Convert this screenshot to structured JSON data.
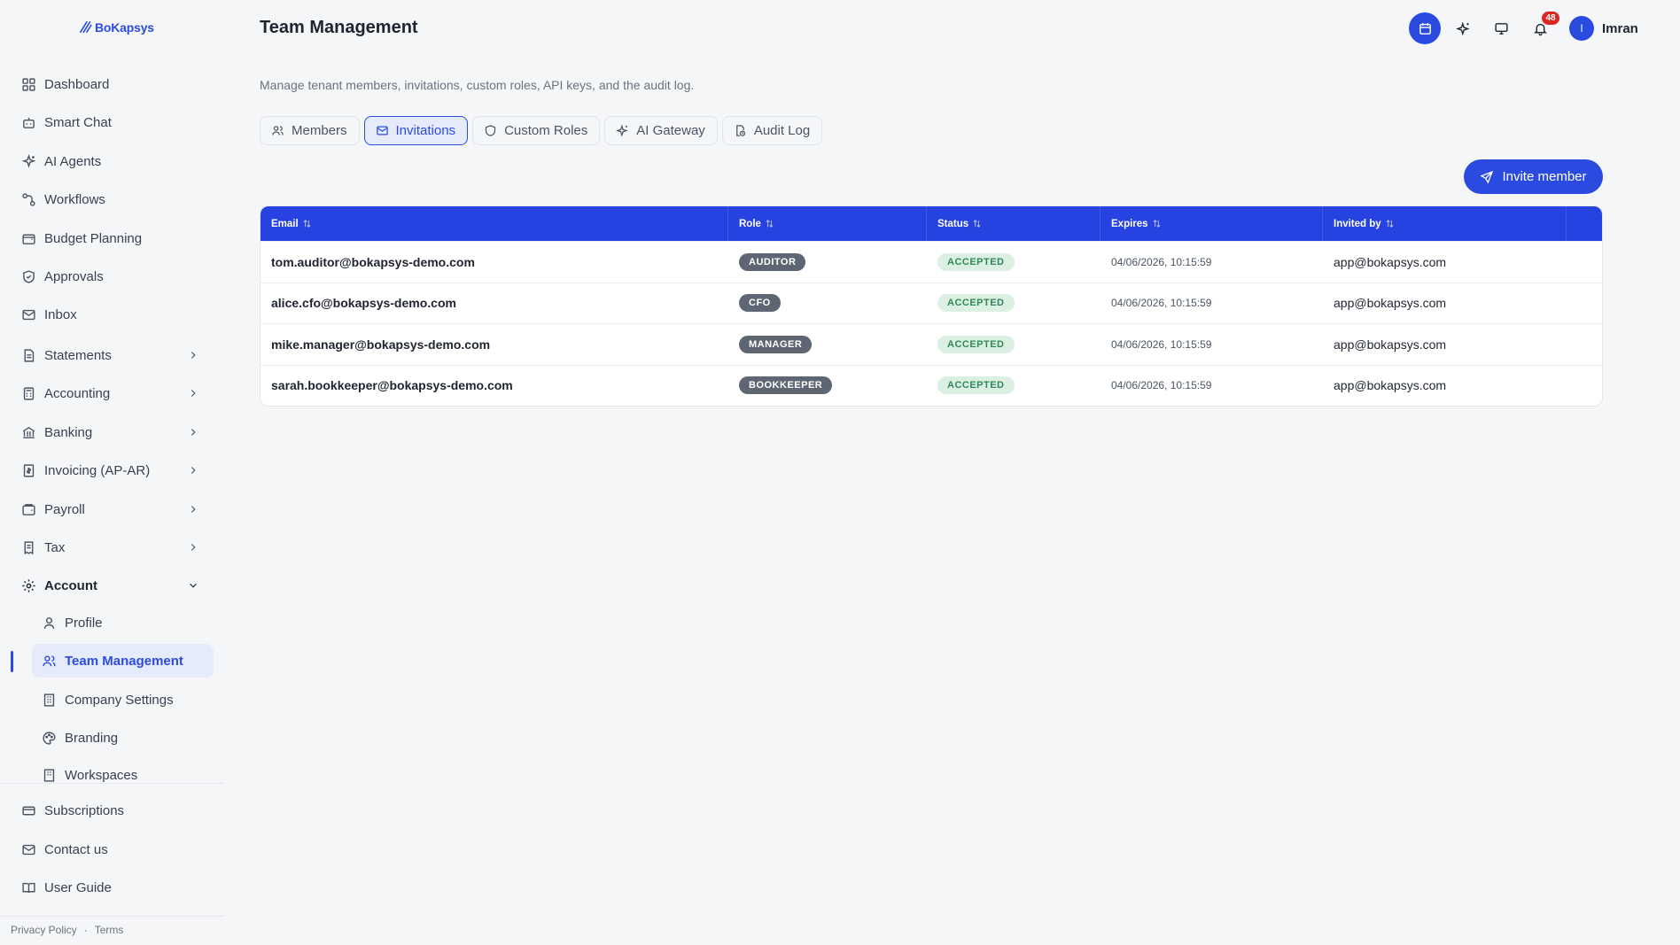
{
  "app": {
    "brand": "BoKapsys"
  },
  "sidebar": {
    "items": [
      {
        "label": "Dashboard",
        "icon": "grid-icon"
      },
      {
        "label": "Smart Chat",
        "icon": "bot-icon"
      },
      {
        "label": "AI Agents",
        "icon": "sparkles-icon"
      },
      {
        "label": "Workflows",
        "icon": "workflow-icon"
      },
      {
        "label": "Budget Planning",
        "icon": "wallet-icon"
      },
      {
        "label": "Approvals",
        "icon": "shield-check-icon"
      },
      {
        "label": "Inbox",
        "icon": "mail-icon"
      },
      {
        "label": "Statements",
        "icon": "document-icon"
      },
      {
        "label": "Accounting",
        "icon": "calculator-icon"
      },
      {
        "label": "Banking",
        "icon": "bank-icon"
      },
      {
        "label": "Invoicing (AP-AR)",
        "icon": "invoice-icon"
      },
      {
        "label": "Payroll",
        "icon": "wallet-icon"
      },
      {
        "label": "Tax",
        "icon": "receipt-icon"
      },
      {
        "label": "Account",
        "icon": "gear-icon"
      }
    ],
    "account_sub": [
      {
        "label": "Profile",
        "icon": "user-icon"
      },
      {
        "label": "Team Management",
        "icon": "users-icon"
      },
      {
        "label": "Company Settings",
        "icon": "building-icon"
      },
      {
        "label": "Branding",
        "icon": "palette-icon"
      },
      {
        "label": "Workspaces",
        "icon": "building-icon"
      }
    ],
    "bottom": [
      {
        "label": "Subscriptions",
        "icon": "card-icon"
      },
      {
        "label": "Contact us",
        "icon": "mail-icon"
      },
      {
        "label": "User Guide",
        "icon": "book-icon"
      }
    ],
    "footer": {
      "privacy": "Privacy Policy",
      "separator": "·",
      "terms": "Terms"
    }
  },
  "header": {
    "title": "Team Management",
    "notifications_count": "48",
    "user_initial": "I",
    "user_name": "Imran"
  },
  "main": {
    "subtitle": "Manage tenant members, invitations, custom roles, API keys, and the audit log.",
    "tabs": [
      {
        "label": "Members",
        "icon": "users-icon"
      },
      {
        "label": "Invitations",
        "icon": "mail-icon",
        "active": true
      },
      {
        "label": "Custom Roles",
        "icon": "shield-icon"
      },
      {
        "label": "AI Gateway",
        "icon": "sparkles-icon"
      },
      {
        "label": "Audit Log",
        "icon": "file-clock-icon"
      }
    ],
    "invite_button": "Invite member"
  },
  "table": {
    "columns": [
      "Email",
      "Role",
      "Status",
      "Expires",
      "Invited by"
    ],
    "rows": [
      {
        "email": "tom.auditor@bokapsys-demo.com",
        "role": "AUDITOR",
        "status": "ACCEPTED",
        "expires": "04/06/2026, 10:15:59",
        "invited_by": "app@bokapsys.com"
      },
      {
        "email": "alice.cfo@bokapsys-demo.com",
        "role": "CFO",
        "status": "ACCEPTED",
        "expires": "04/06/2026, 10:15:59",
        "invited_by": "app@bokapsys.com"
      },
      {
        "email": "mike.manager@bokapsys-demo.com",
        "role": "MANAGER",
        "status": "ACCEPTED",
        "expires": "04/06/2026, 10:15:59",
        "invited_by": "app@bokapsys.com"
      },
      {
        "email": "sarah.bookkeeper@bokapsys-demo.com",
        "role": "BOOKKEEPER",
        "status": "ACCEPTED",
        "expires": "04/06/2026, 10:15:59",
        "invited_by": "app@bokapsys.com"
      }
    ]
  },
  "colors": {
    "accent": "#2b4be0",
    "header_bg": "#2643e1",
    "role_pill": "#5f6673",
    "status_bg": "#dcefe3",
    "status_fg": "#2f8a55",
    "badge": "#dc2626"
  }
}
